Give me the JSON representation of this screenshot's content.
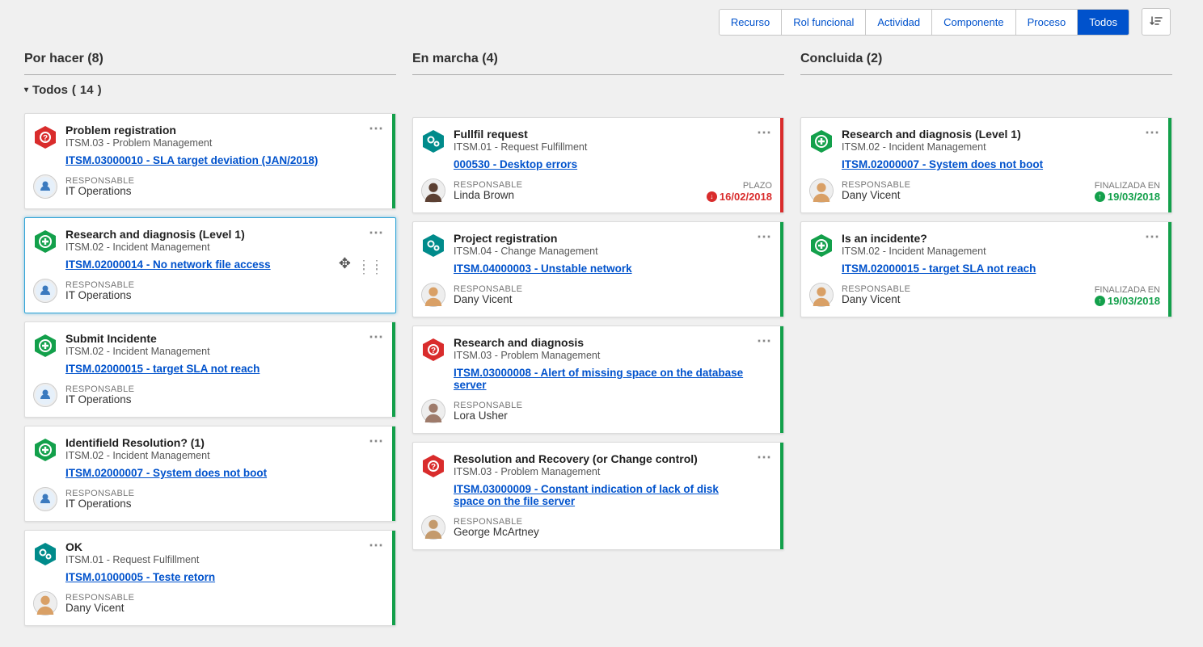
{
  "toolbar": {
    "filters": [
      "Recurso",
      "Rol funcional",
      "Actividad",
      "Componente",
      "Proceso",
      "Todos"
    ],
    "active_filter_index": 5,
    "sort_icon": "sort"
  },
  "group": {
    "label": "Todos",
    "count": 14
  },
  "columns": [
    {
      "title": "Por hacer",
      "count": 8,
      "cards": [
        {
          "type": "problem",
          "title": "Problem registration",
          "subtitle": "ITSM.03 - Problem Management",
          "link": "ITSM.03000010 - SLA target deviation (JAN/2018)",
          "resp_label": "RESPONSABLE",
          "resp_value": "IT Operations",
          "avatar": "team",
          "stripe": "green"
        },
        {
          "type": "incident",
          "title": "Research and diagnosis (Level 1)",
          "subtitle": "ITSM.02 - Incident Management",
          "link": "ITSM.02000014 - No network file access",
          "resp_label": "RESPONSABLE",
          "resp_value": "IT Operations",
          "avatar": "team",
          "stripe": "",
          "selected": true,
          "grip": true
        },
        {
          "type": "incident",
          "title": "Submit Incidente",
          "subtitle": "ITSM.02 - Incident Management",
          "link": "ITSM.02000015 - target SLA not reach",
          "resp_label": "RESPONSABLE",
          "resp_value": "IT Operations",
          "avatar": "team",
          "stripe": "green"
        },
        {
          "type": "incident",
          "title": "Identifield Resolution? (1)",
          "subtitle": "ITSM.02 - Incident Management",
          "link": "ITSM.02000007 - System does not boot",
          "resp_label": "RESPONSABLE",
          "resp_value": "IT Operations",
          "avatar": "team",
          "stripe": "green"
        },
        {
          "type": "request",
          "title": "OK",
          "subtitle": "ITSM.01 - Request Fulfillment",
          "link": "ITSM.01000005 - Teste retorn",
          "resp_label": "RESPONSABLE",
          "resp_value": "Dany Vicent",
          "avatar": "user-dany",
          "stripe": "green"
        }
      ]
    },
    {
      "title": "En marcha",
      "count": 4,
      "cards": [
        {
          "type": "request",
          "title": "Fullfil request",
          "subtitle": "ITSM.01 - Request Fulfillment",
          "link": "000530 - Desktop errors",
          "resp_label": "RESPONSABLE",
          "resp_value": "Linda Brown",
          "avatar": "user-linda",
          "stripe": "red",
          "deadline_label": "PLAZO",
          "deadline_value": "16/02/2018",
          "deadline_color": "red",
          "deadline_icon": "down"
        },
        {
          "type": "request",
          "title": "Project registration",
          "subtitle": "ITSM.04 - Change Management",
          "link": "ITSM.04000003 - Unstable network",
          "resp_label": "RESPONSABLE",
          "resp_value": "Dany Vicent",
          "avatar": "user-dany",
          "stripe": "green"
        },
        {
          "type": "problem",
          "title": "Research and diagnosis",
          "subtitle": "ITSM.03 - Problem Management",
          "link": "ITSM.03000008 - Alert of missing space on the database server",
          "resp_label": "RESPONSABLE",
          "resp_value": "Lora Usher",
          "avatar": "user-lora",
          "stripe": "green"
        },
        {
          "type": "problem",
          "title": "Resolution and Recovery (or Change control)",
          "subtitle": "ITSM.03 - Problem Management",
          "link": "ITSM.03000009 - Constant indication of lack of disk space on the file server",
          "resp_label": "RESPONSABLE",
          "resp_value": "George McArtney",
          "avatar": "user-george",
          "stripe": "green"
        }
      ]
    },
    {
      "title": "Concluida",
      "count": 2,
      "cards": [
        {
          "type": "incident",
          "title": "Research and diagnosis (Level 1)",
          "subtitle": "ITSM.02 - Incident Management",
          "link": "ITSM.02000007 - System does not boot",
          "resp_label": "RESPONSABLE",
          "resp_value": "Dany Vicent",
          "avatar": "user-dany",
          "stripe": "green",
          "deadline_label": "FINALIZADA EN",
          "deadline_value": "19/03/2018",
          "deadline_color": "green",
          "deadline_icon": "up"
        },
        {
          "type": "incident",
          "title": "Is an incidente?",
          "subtitle": "ITSM.02 - Incident Management",
          "link": "ITSM.02000015 - target SLA not reach",
          "resp_label": "RESPONSABLE",
          "resp_value": "Dany Vicent",
          "avatar": "user-dany",
          "stripe": "green",
          "deadline_label": "FINALIZADA EN",
          "deadline_value": "19/03/2018",
          "deadline_color": "green",
          "deadline_icon": "up"
        }
      ]
    }
  ]
}
